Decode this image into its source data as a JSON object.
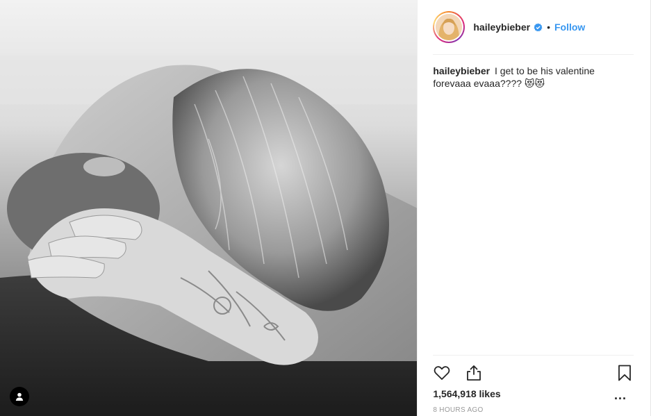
{
  "post": {
    "username": "haileybieber",
    "follow_label": "Follow",
    "separator": "•",
    "caption_user": "haileybieber",
    "caption_text": "I get to be his valentine forevaaa evaaa???? 😻😻",
    "likes": "1,564,918 likes",
    "timestamp": "8 HOURS AGO",
    "more_label": "..."
  },
  "colors": {
    "link_blue": "#3897f0",
    "verified_blue": "#3897f0",
    "text": "#262626",
    "muted": "#999999"
  },
  "icons": [
    "person-icon",
    "verified-badge-icon",
    "heart-icon",
    "share-icon",
    "bookmark-icon",
    "more-icon"
  ]
}
